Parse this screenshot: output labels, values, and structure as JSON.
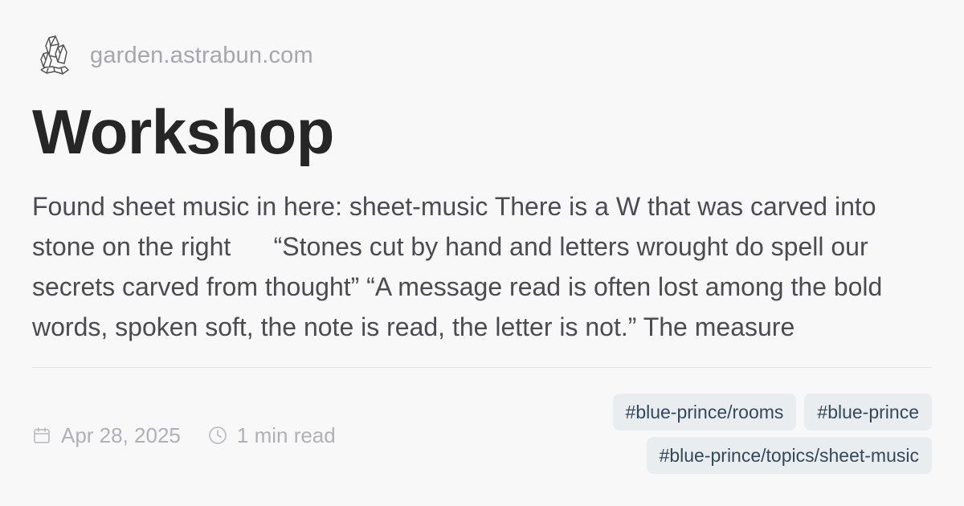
{
  "site": {
    "logo_icon": "crystal-icon",
    "name": "garden.astrabun.com"
  },
  "page": {
    "title": "Workshop",
    "excerpt": "Found sheet music in here: sheet-music There is a W that was carved into stone on the right      “Stones cut by hand and letters wrought do spell our secrets carved from thought” “A message read is often lost among the bold words, spoken soft, the note is read, the letter is not.” The measure"
  },
  "meta": {
    "date_icon": "calendar-icon",
    "date": "Apr 28, 2025",
    "read_icon": "clock-icon",
    "read_time": "1 min read"
  },
  "tags": [
    "#blue-prince/rooms",
    "#blue-prince",
    "#blue-prince/topics/sheet-music"
  ],
  "colors": {
    "background": "#f8f8f9",
    "title": "#262626",
    "body_text": "#4b4b50",
    "muted": "#b0b0b6",
    "tag_background": "#eaedf0",
    "tag_text": "#33485b"
  }
}
